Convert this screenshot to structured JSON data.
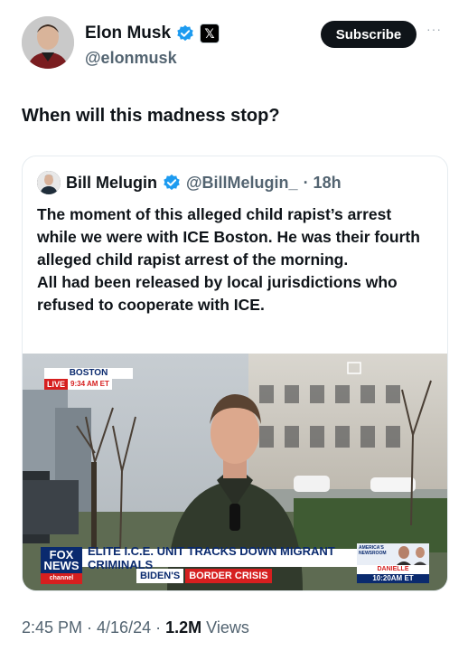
{
  "author": {
    "name": "Elon Musk",
    "handle": "@elonmusk",
    "verified_icon": "verified-badge-icon",
    "affiliation_icon": "x-logo-icon"
  },
  "header": {
    "subscribe_label": "Subscribe",
    "more_label": "···"
  },
  "tweet": {
    "text": "When will this madness stop?"
  },
  "quote": {
    "name": "Bill Melugin",
    "handle": "@BillMelugin_",
    "time": "· 18h",
    "text_1": "The moment of this alleged child rapist’s arrest while we were with ICE Boston. He was their fourth alleged child rapist arrest of the morning.",
    "text_2": "All had been released by local jurisdictions who refused to cooperate with ICE.",
    "media": {
      "location": "BOSTON",
      "live": "LIVE",
      "live_time": "9:34 AM ET",
      "network_line1": "FOX",
      "network_line2": "NEWS",
      "network_line3": "channel",
      "headline": "ELITE I.C.E. UNIT TRACKS DOWN MIGRANT CRIMINALS",
      "sub_a": "BIDEN'S",
      "sub_b": "BORDER CRISIS",
      "side_name": "DANIELLE GERSHKOFF",
      "side_time": "10:20AM ET",
      "side_show": "AMERICA'S NEWSROOM"
    }
  },
  "meta": {
    "time_date": "2:45 PM · 4/16/24 ·",
    "views_count": "1.2M",
    "views_label": "Views"
  },
  "colors": {
    "accent_blue": "#1d9bf0",
    "fox_navy": "#0a2a6e",
    "fox_red": "#d61f1f"
  }
}
